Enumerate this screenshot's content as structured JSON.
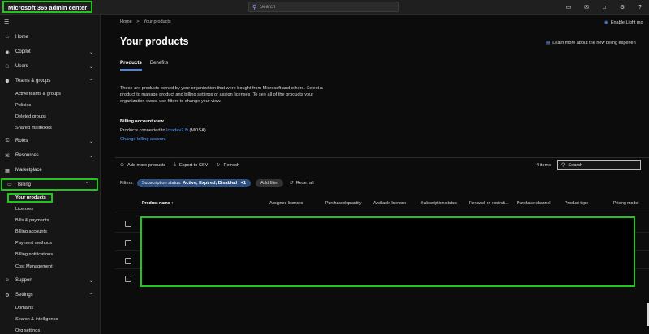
{
  "app": {
    "title": "Microsoft 365 admin center",
    "search_placeholder": "Search"
  },
  "topbar_icons": [
    "screen-icon",
    "mail-icon",
    "bell-icon",
    "gear-icon",
    "help-icon"
  ],
  "sidebar": {
    "items": [
      {
        "id": "home",
        "label": "Home",
        "icon": "⌂"
      },
      {
        "id": "copilot",
        "label": "Copilot",
        "icon": "◉",
        "chevron": "⌄"
      },
      {
        "id": "users",
        "label": "Users",
        "icon": "⚇",
        "chevron": "⌄"
      },
      {
        "id": "teams",
        "label": "Teams & groups",
        "icon": "⚈",
        "chevron": "⌃"
      },
      {
        "id": "roles",
        "label": "Roles",
        "icon": "⚿",
        "chevron": "⌄"
      },
      {
        "id": "resources",
        "label": "Resources",
        "icon": "⌘",
        "chevron": "⌄"
      },
      {
        "id": "marketplace",
        "label": "Marketplace",
        "icon": "▦"
      },
      {
        "id": "billing",
        "label": "Billing",
        "icon": "▭",
        "chevron": "⌃"
      },
      {
        "id": "support",
        "label": "Support",
        "icon": "☺",
        "chevron": "⌄"
      },
      {
        "id": "settings",
        "label": "Settings",
        "icon": "⚙",
        "chevron": "⌃"
      }
    ],
    "teams_sub": [
      "Active teams & groups",
      "Policies",
      "Deleted groups",
      "Shared mailboxes"
    ],
    "billing_sub": [
      "Your products",
      "Licenses",
      "Bills & payments",
      "Billing accounts",
      "Payment methods",
      "Billing notifications",
      "Cost Management"
    ],
    "settings_sub": [
      "Domains",
      "Search & intelligence",
      "Org settings"
    ]
  },
  "main": {
    "breadcrumb": [
      "Home",
      ">",
      "Your products"
    ],
    "light_mode_label": "Enable Light mo",
    "title": "Your products",
    "learn_link": "Learn more about the new billing experien",
    "tabs": [
      "Products",
      "Benefits"
    ],
    "description": "These are products owned by your organization that were bought from Microsoft and others. Select a product to manage product and billing settings or assign licenses. To see all of the products your organization owns. use filters to change your view.",
    "billing_view_title": "Billing account view",
    "billing_view_prefix": "Products connected to",
    "billing_view_account": "lcradev7",
    "billing_view_suffix": "(MOSA)",
    "change_billing": "Change billing account",
    "toolbar": {
      "add_more": "Add more products",
      "export": "Export to CSV",
      "refresh": "Refresh",
      "items_count": "4 items",
      "search_placeholder": "Search"
    },
    "filters": {
      "label": "Filters:",
      "pill_prefix": "Subscription status:",
      "pill_value": "Active, Expired, Disabled , +1",
      "add_filter": "Add filter",
      "reset": "Reset all"
    },
    "columns": [
      "Product name ↑",
      "Assigned licenses",
      "Purchased quantity",
      "Available licenses",
      "Subscription status",
      "Renewal or expirati...",
      "Purchase channel",
      "Product type",
      "Pricing model"
    ]
  }
}
